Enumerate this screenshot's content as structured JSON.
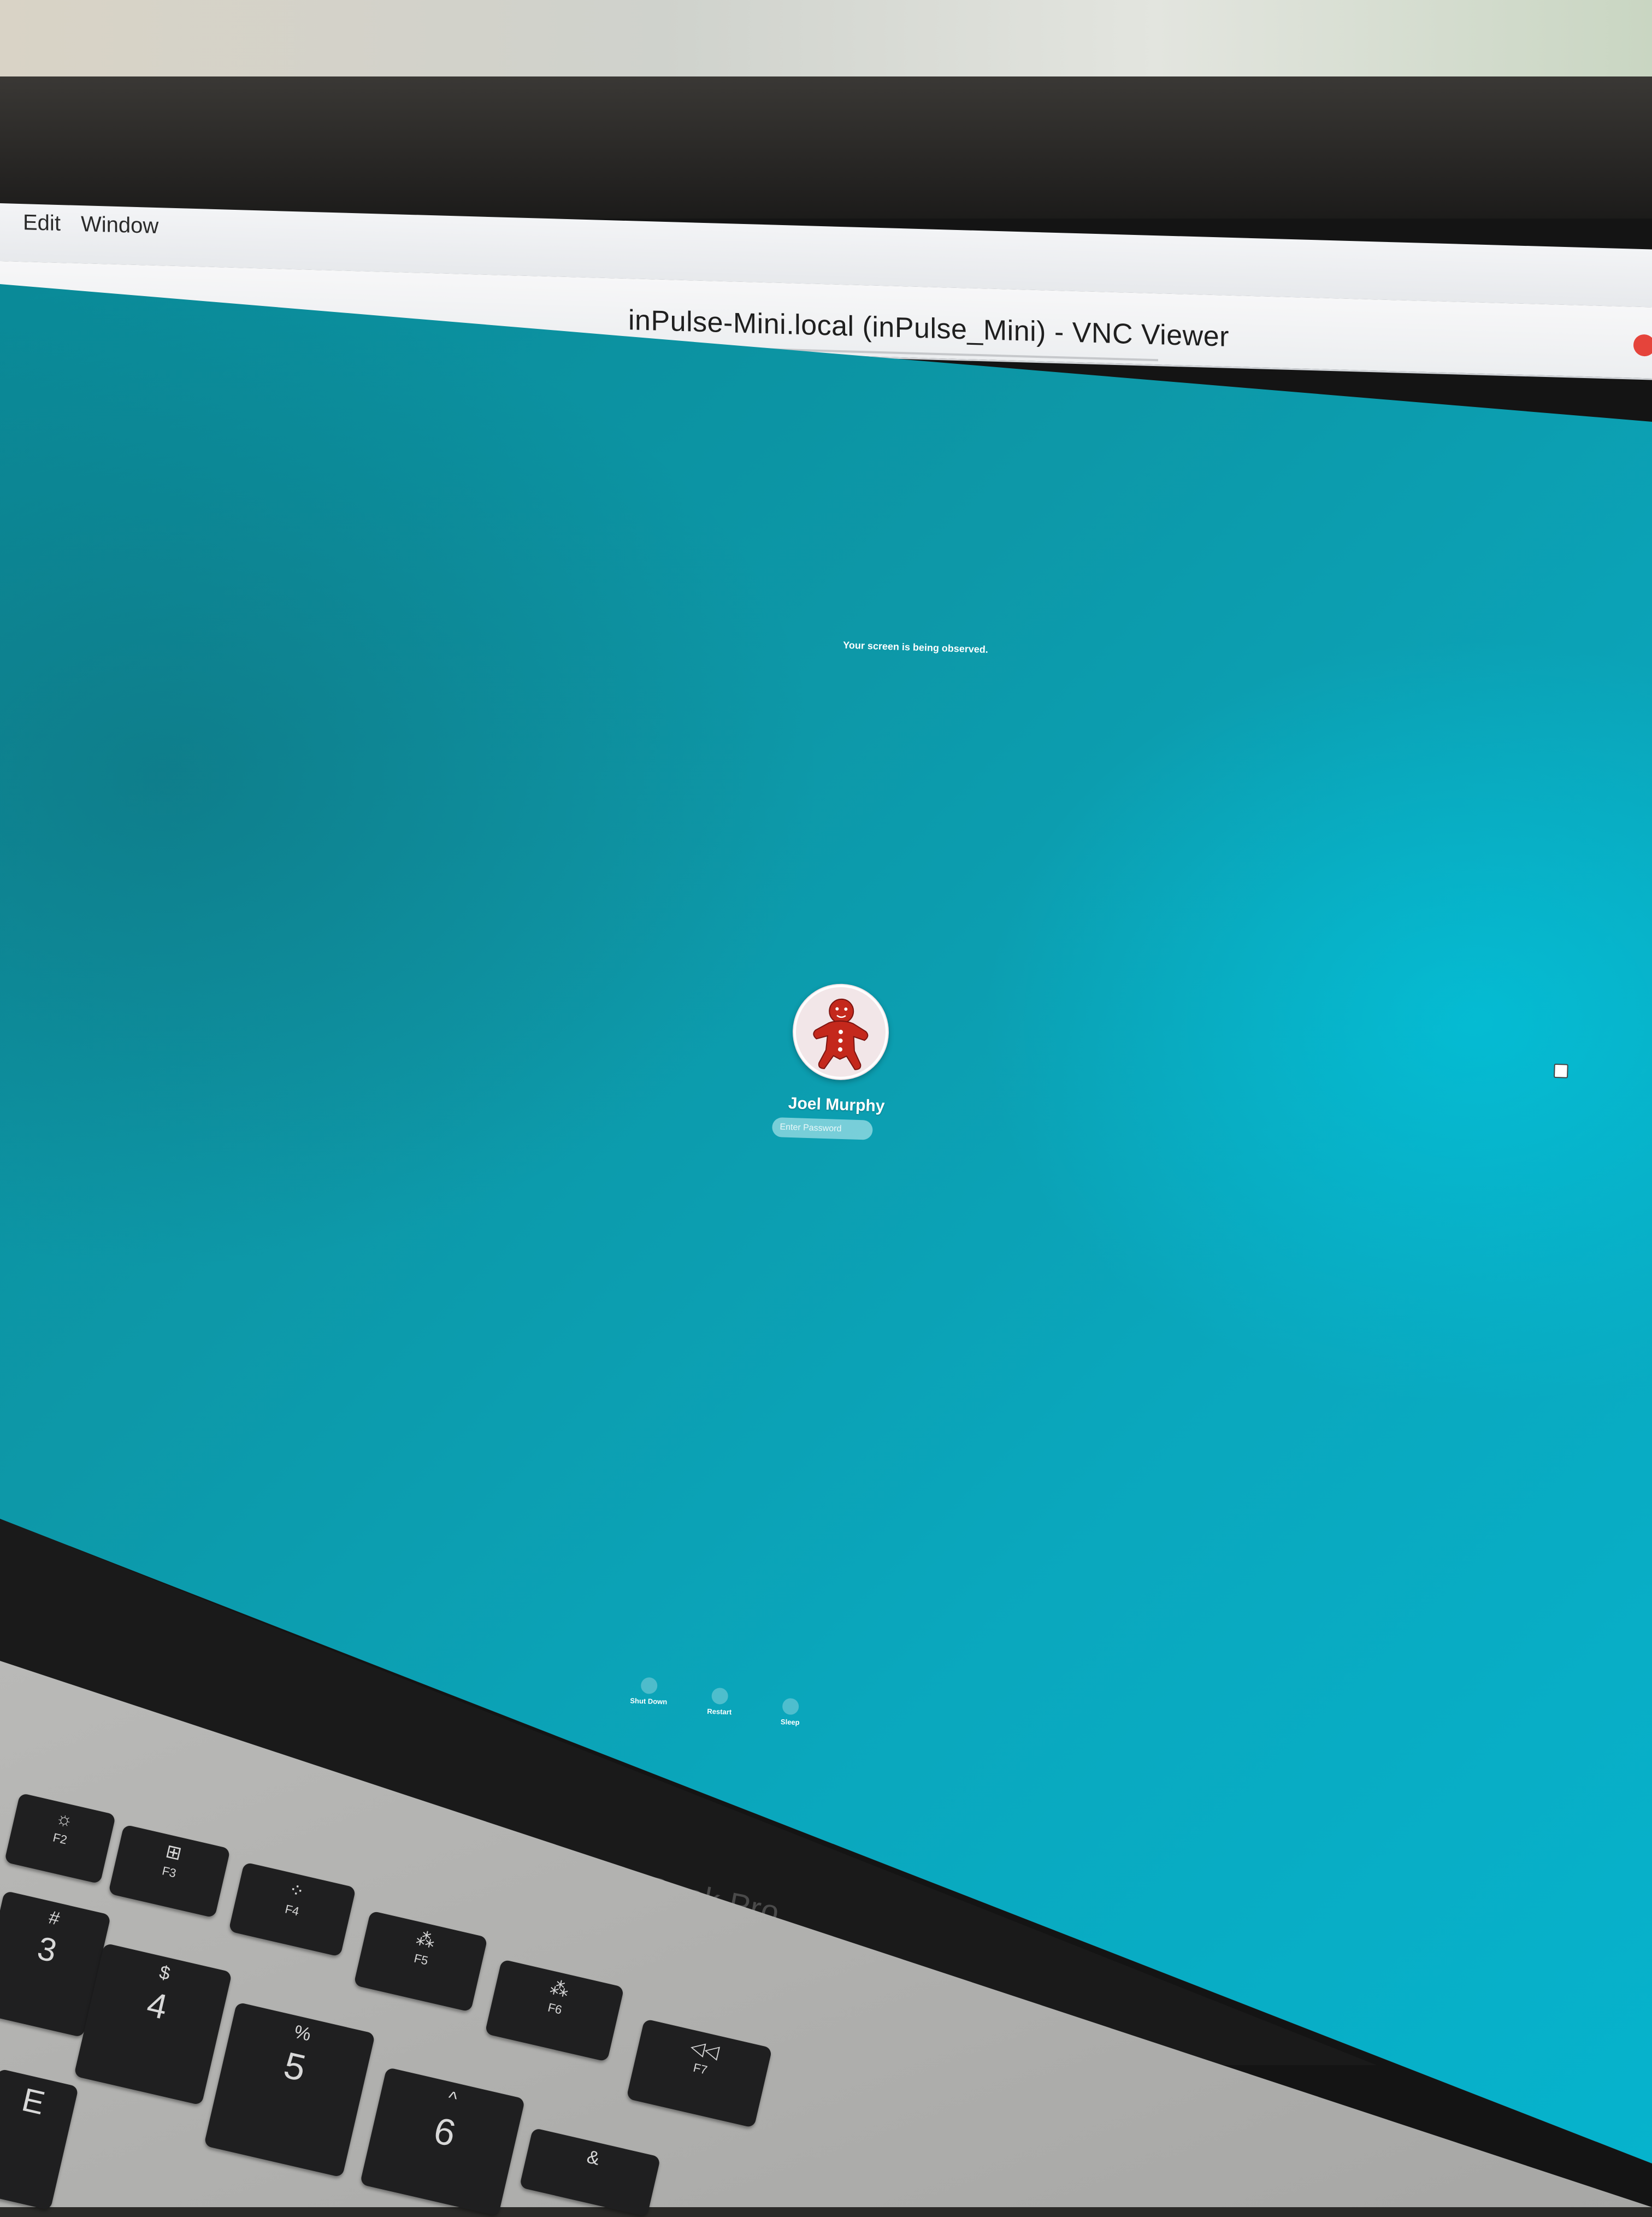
{
  "host_menu": {
    "items": [
      "Edit",
      "Window"
    ]
  },
  "window": {
    "title": "inPulse-Mini.local (inPulse_Mini) - VNC Viewer"
  },
  "login_screen": {
    "observed_notice": "Your screen is being observed.",
    "user": {
      "name": "Joel Murphy",
      "avatar_icon": "gingerbread-man-icon"
    },
    "password_placeholder": "Enter Password",
    "actions": [
      {
        "label": "Shut Down",
        "icon": "power-icon"
      },
      {
        "label": "Restart",
        "icon": "restart-icon"
      },
      {
        "label": "Sleep",
        "icon": "sleep-icon"
      }
    ]
  },
  "laptop": {
    "brand": "MacBook Pro",
    "keys": [
      {
        "top": "☼",
        "bottom": "F2"
      },
      {
        "top": "⊞",
        "bottom": "F3"
      },
      {
        "top": "⁘",
        "bottom": "F4"
      },
      {
        "top": "⁂",
        "bottom": "F5"
      },
      {
        "top": "⁂",
        "bottom": "F6"
      },
      {
        "top": "◁◁",
        "bottom": "F7"
      },
      {
        "top": "#",
        "bottom": "3"
      },
      {
        "top": "$",
        "bottom": "4"
      },
      {
        "top": "%",
        "bottom": "5"
      },
      {
        "top": "^",
        "bottom": "6"
      },
      {
        "top": "&",
        "bottom": ""
      },
      {
        "top": "",
        "bottom": "E"
      }
    ]
  },
  "colors": {
    "desktop_teal": "#0a9fb2",
    "avatar_red": "#c4281c"
  }
}
